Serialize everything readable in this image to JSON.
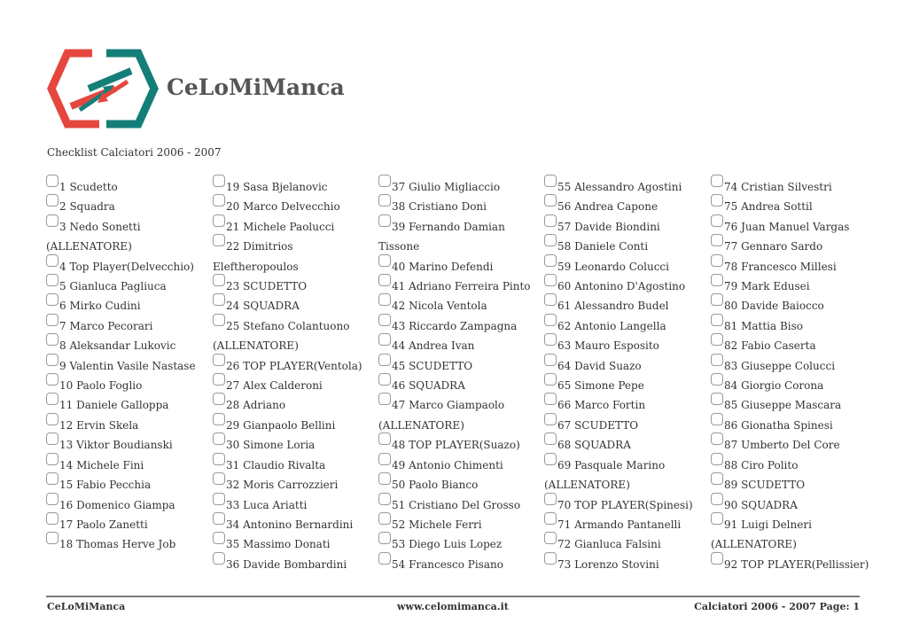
{
  "brand": {
    "name": "CeLoMiManca",
    "logo_icon": "exchange-arrows-hexagon-icon",
    "colors": {
      "red": "#e5473e",
      "teal": "#147e78",
      "text": "#555555"
    }
  },
  "subtitle": "Checklist Calciatori 2006 - 2007",
  "columns": [
    [
      "1 Scudetto",
      "2 Squadra",
      "3 Nedo Sonetti (ALLENATORE)",
      "4 Top Player(Delvecchio)",
      "5 Gianluca Pagliuca",
      "6 Mirko Cudini",
      "7 Marco Pecorari",
      "8 Aleksandar Lukovic",
      "9 Valentin Vasile Nastase",
      "10 Paolo Foglio",
      "11 Daniele Galloppa",
      "12 Ervin Skela",
      "13 Viktor Boudianski",
      "14 Michele Fini",
      "15 Fabio Pecchia",
      "16 Domenico Giampa",
      "17 Paolo Zanetti",
      "18 Thomas Herve Job"
    ],
    [
      "19 Sasa Bjelanovic",
      "20 Marco Delvecchio",
      "21 Michele Paolucci",
      "22 Dimitrios Eleftheropoulos",
      "23 SCUDETTO",
      "24 SQUADRA",
      "25 Stefano Colantuono (ALLENATORE)",
      "26 TOP PLAYER(Ventola)",
      "27 Alex Calderoni",
      "28 Adriano",
      "29 Gianpaolo Bellini",
      "30 Simone Loria",
      "31 Claudio Rivalta",
      "32 Moris Carrozzieri",
      "33 Luca Ariatti",
      "34 Antonino Bernardini",
      "35 Massimo Donati",
      "36 Davide Bombardini"
    ],
    [
      "37 Giulio Migliaccio",
      "38 Cristiano Doni",
      "39 Fernando Damian Tissone",
      "40 Marino Defendi",
      "41 Adriano Ferreira Pinto",
      "42 Nicola Ventola",
      "43 Riccardo Zampagna",
      "44 Andrea Ivan",
      "45 SCUDETTO",
      "46 SQUADRA",
      "47 Marco Giampaolo (ALLENATORE)",
      "48 TOP PLAYER(Suazo)",
      "49 Antonio Chimenti",
      "50 Paolo Bianco",
      "51 Cristiano Del Grosso",
      "52 Michele Ferri",
      "53 Diego Luis Lopez",
      "54 Francesco Pisano"
    ],
    [
      "55 Alessandro Agostini",
      "56 Andrea Capone",
      "57 Davide Biondini",
      "58 Daniele Conti",
      "59 Leonardo Colucci",
      "60 Antonino D'Agostino",
      "61 Alessandro Budel",
      "62 Antonio Langella",
      "63 Mauro Esposito",
      "64 David Suazo",
      "65 Simone Pepe",
      "66 Marco Fortin",
      "67 SCUDETTO",
      "68 SQUADRA",
      "69 Pasquale Marino (ALLENATORE)",
      "70 TOP PLAYER(Spinesi)",
      "71 Armando Pantanelli",
      "72 Gianluca Falsini",
      "73 Lorenzo Stovini"
    ],
    [
      "74 Cristian Silvestri",
      "75 Andrea Sottil",
      "76 Juan Manuel Vargas",
      "77 Gennaro Sardo",
      "78 Francesco Millesi",
      "79 Mark Edusei",
      "80 Davide Baiocco",
      "81 Mattia Biso",
      "82 Fabio Caserta",
      "83 Giuseppe Colucci",
      "84 Giorgio Corona",
      "85 Giuseppe Mascara",
      "86 Gionatha Spinesi",
      "87 Umberto Del Core",
      "88 Ciro Polito",
      "89 SCUDETTO",
      "90 SQUADRA",
      "91 Luigi Delneri (ALLENATORE)",
      "92 TOP PLAYER(Pellissier)"
    ]
  ],
  "footer": {
    "left": "CeLoMiManca",
    "center": "www.celomimanca.it",
    "right": "Calciatori 2006 - 2007 Page: 1"
  }
}
